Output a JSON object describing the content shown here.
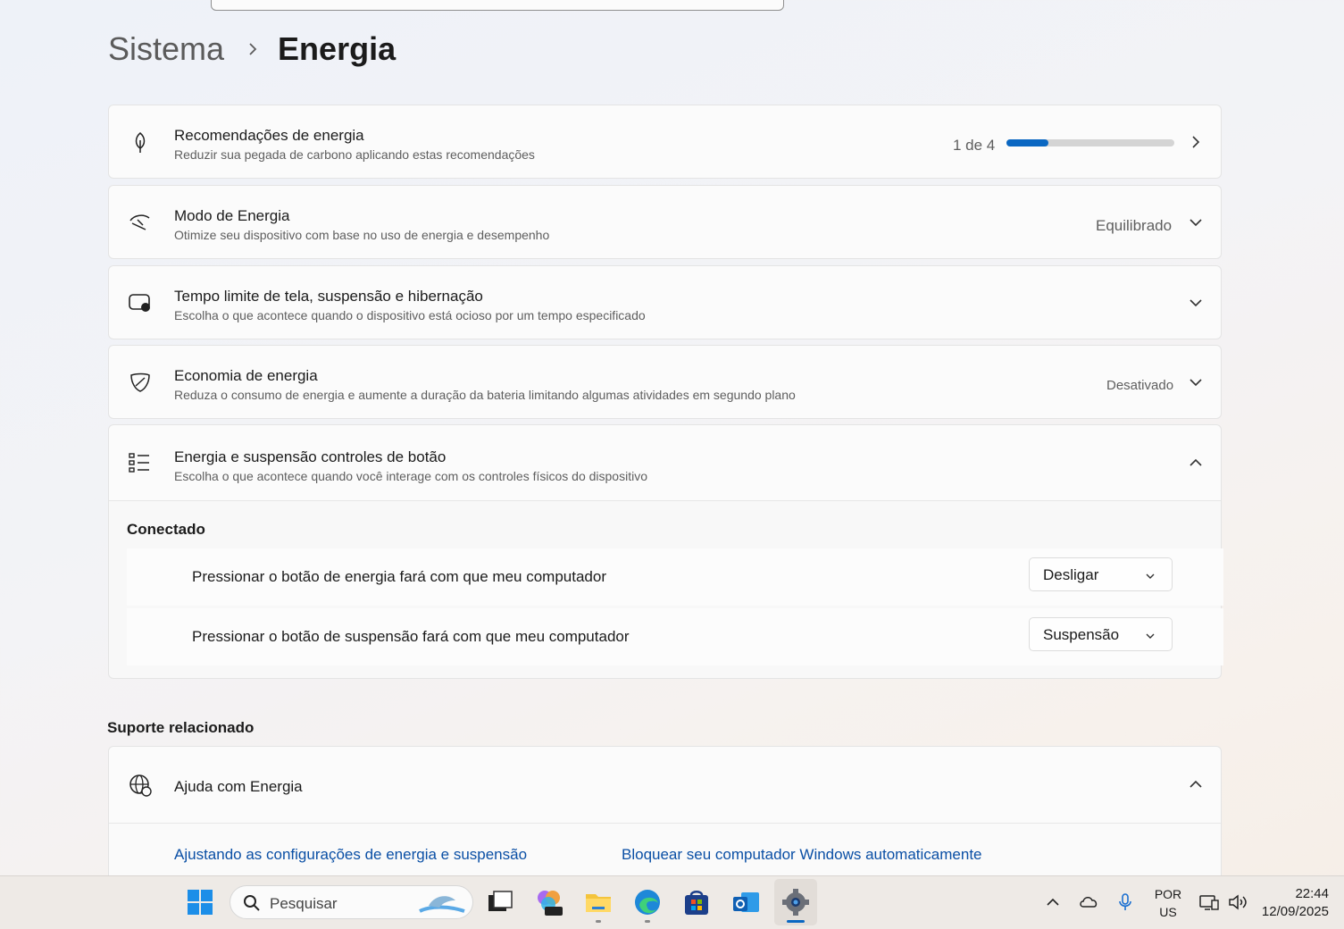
{
  "breadcrumb": {
    "parent": "Sistema",
    "current": "Energia"
  },
  "cards": {
    "recommendations": {
      "title": "Recomendações de energia",
      "subtitle": "Reduzir sua pegada de carbono aplicando estas recomendações",
      "progress_label": "1 de 4",
      "progress_fraction": 0.25
    },
    "power_mode": {
      "title": "Modo de Energia",
      "subtitle": "Otimize seu dispositivo com base no uso de energia e desempenho",
      "value": "Equilibrado"
    },
    "screen_timeout": {
      "title": "Tempo limite de tela, suspensão e hibernação",
      "subtitle": "Escolha o que acontece quando o dispositivo está ocioso por um tempo especificado"
    },
    "energy_saver": {
      "title": "Economia de energia",
      "subtitle": "Reduza o consumo de energia e aumente a duração da bateria limitando algumas atividades em segundo plano",
      "value": "Desativado"
    },
    "button_controls": {
      "title": "Energia e suspensão controles de botão",
      "subtitle": "Escolha o que acontece quando você interage com os controles físicos do dispositivo",
      "section_label": "Conectado",
      "rows": [
        {
          "label": "Pressionar o botão de energia fará com que meu computador",
          "value": "Desligar"
        },
        {
          "label": "Pressionar o botão de suspensão fará com que meu computador",
          "value": "Suspensão"
        }
      ]
    }
  },
  "related": {
    "title": "Suporte relacionado",
    "help_title": "Ajuda com Energia",
    "links": [
      "Ajustando as configurações de energia e suspensão",
      "Bloquear seu computador Windows automaticamente"
    ]
  },
  "taskbar": {
    "search_placeholder": "Pesquisar",
    "language": "POR",
    "layout": "US",
    "time": "22:44",
    "date": "12/09/2025"
  },
  "colors": {
    "accent": "#0a67c2",
    "link": "#0a4fa5"
  }
}
